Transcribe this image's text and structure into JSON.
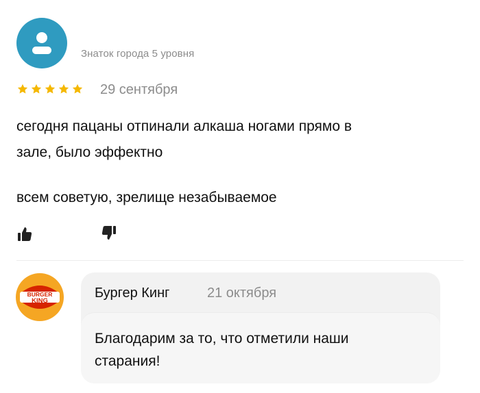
{
  "reviewer": {
    "level": "Знаток города 5 уровня",
    "avatar_icon": "user-icon"
  },
  "review": {
    "rating": 5,
    "rating_max": 5,
    "date": "29 сентября",
    "lines": [
      "сегодня пацаны отпинали алкаша ногами прямо в",
      "зале, было эффектно",
      "всем советую, зрелище незабываемое"
    ],
    "like_icon": "thumbs-up-icon",
    "dislike_icon": "thumbs-down-icon"
  },
  "reply": {
    "logo_text_top": "BURGER",
    "logo_text_bottom": "KING",
    "author": "Бургер Кинг",
    "date": "21 октября",
    "lines": [
      "Благодарим за то, что отметили наши",
      "старания!"
    ]
  },
  "colors": {
    "avatar": "#2f9bc0",
    "star": "#f5b800",
    "muted_text": "#8c8c8c",
    "card": "#f2f2f2",
    "bk_red": "#d62300",
    "bk_orange": "#f5a623"
  }
}
